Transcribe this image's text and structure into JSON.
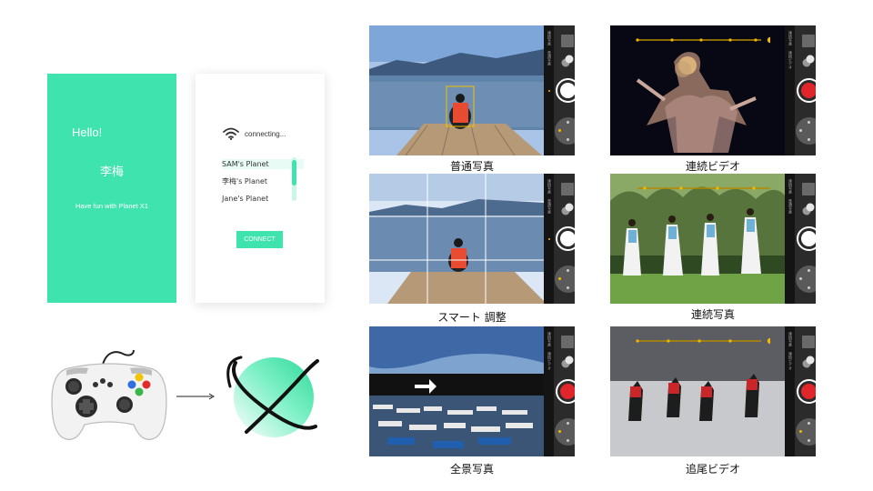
{
  "welcome": {
    "greeting": "Hello!",
    "user_name": "李梅",
    "tagline": "Have fun with  Planet X1"
  },
  "connecting": {
    "status": "connecting...",
    "planets": [
      {
        "name": "SAM's Planet",
        "selected": true
      },
      {
        "name": "李梅's Planet",
        "selected": false
      },
      {
        "name": "Jane's Planet",
        "selected": false
      }
    ],
    "connect_label": "CONNECT"
  },
  "colors": {
    "brand_green": "#3ee3ad",
    "record_red": "#e0252b",
    "accent_yellow": "#f5b800"
  },
  "modes": [
    {
      "caption": "普通写真",
      "shutter": "photo",
      "scene": "lake-center"
    },
    {
      "caption": "連続ビデオ",
      "shutter": "record",
      "scene": "dancer-trails"
    },
    {
      "caption": "スマート 調整",
      "shutter": "photo",
      "scene": "lake-grid"
    },
    {
      "caption": "連続写真",
      "shutter": "photo",
      "scene": "dancers-grass"
    },
    {
      "caption": "全景写真",
      "shutter": "record",
      "scene": "harbor-panorama"
    },
    {
      "caption": "追尾ビデオ",
      "shutter": "record",
      "scene": "dance-studio"
    }
  ],
  "rail_labels": [
    "連続写真",
    "普通写真",
    "連続ビデオ"
  ],
  "icons": {
    "wifi": "wifi-icon",
    "gamepad": "gamepad-icon",
    "arrow": "arrow-right-icon",
    "planet": "planet-logo-icon"
  }
}
